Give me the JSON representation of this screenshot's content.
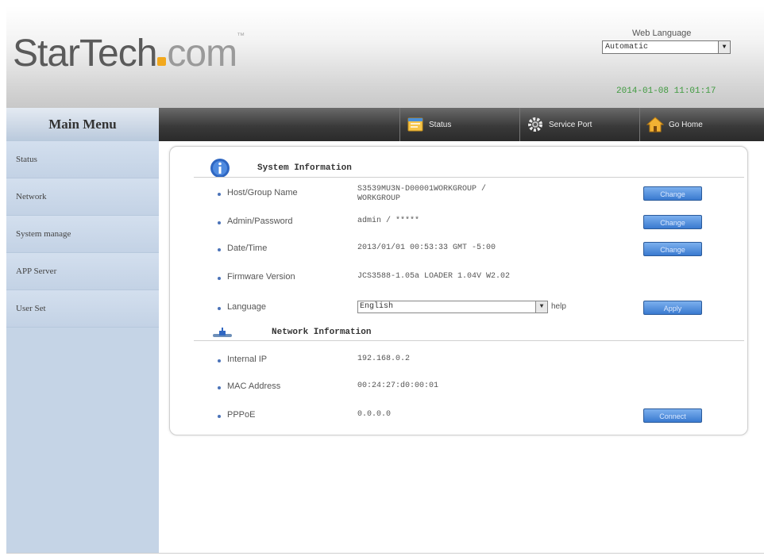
{
  "header": {
    "logo_main": "StarTech",
    "logo_suffix": "com",
    "logo_tm": "™",
    "web_language_label": "Web Language",
    "web_language_value": "Automatic",
    "datetime": "2014-01-08 11:01:17"
  },
  "sidebar": {
    "title": "Main Menu",
    "items": [
      {
        "label": "Status"
      },
      {
        "label": "Network"
      },
      {
        "label": "System manage"
      },
      {
        "label": "APP Server"
      },
      {
        "label": "User Set"
      }
    ]
  },
  "nav": {
    "status": "Status",
    "service_port": "Service Port",
    "go_home": "Go Home"
  },
  "system_info": {
    "title": "System Information",
    "rows": [
      {
        "label": "Host/Group Name",
        "value_line1": "S3539MU3N-D00001WORKGROUP /",
        "value_line2": "WORKGROUP",
        "button": "Change"
      },
      {
        "label": "Admin/Password",
        "value": "admin / *****",
        "button": "Change"
      },
      {
        "label": "Date/Time",
        "value": "2013/01/01 00:53:33 GMT -5:00",
        "button": "Change"
      },
      {
        "label": "Firmware Version",
        "value": "JCS3588-1.05a LOADER 1.04V W2.02"
      },
      {
        "label": "Language",
        "select_value": "English",
        "help": "help",
        "button": "Apply"
      }
    ]
  },
  "network_info": {
    "title": "Network Information",
    "rows": [
      {
        "label": "Internal IP",
        "value": "192.168.0.2"
      },
      {
        "label": "MAC Address",
        "value": "00:24:27:d0:00:01"
      },
      {
        "label": "PPPoE",
        "value": "0.0.0.0",
        "button": "Connect"
      }
    ]
  },
  "colors": {
    "accent_orange": "#f2a81d",
    "datetime_green": "#3f9a3f",
    "button_blue": "#3a7ad0",
    "sidebar_bg": "#c5d4e6"
  }
}
